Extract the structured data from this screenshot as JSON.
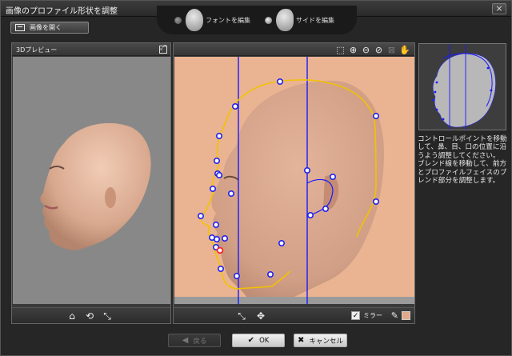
{
  "window": {
    "title": "画像のプロファイル形状を調整",
    "close_glyph": "×"
  },
  "modes": [
    {
      "label": "フォントを編集",
      "selected": false
    },
    {
      "label": "サイドを編集",
      "selected": true
    }
  ],
  "toolbar": {
    "open_image_label": "画像を開く"
  },
  "preview_panel": {
    "title": "3Dプレビュー"
  },
  "editor_panel": {
    "mirror_label": "ミラー",
    "mirror_checked": true,
    "mirror_check_glyph": "✓",
    "blend_color": "#e0a988"
  },
  "help_text": {
    "line1": "コントロールポイントを移動して、鼻、目、口の位置に沿うよう調整してください。",
    "line2": "ブレンド線を移動して、前方とプロファイルフェイスのブレンド部分を調整します。"
  },
  "buttons": {
    "back_label": "戻る",
    "ok_label": "OK",
    "cancel_label": "キャンセル"
  },
  "colors": {
    "profile_line": "#f2c200",
    "blend_line": "#1a1aff",
    "control_point": "#2020ee",
    "selected_point": "#ff2020"
  }
}
